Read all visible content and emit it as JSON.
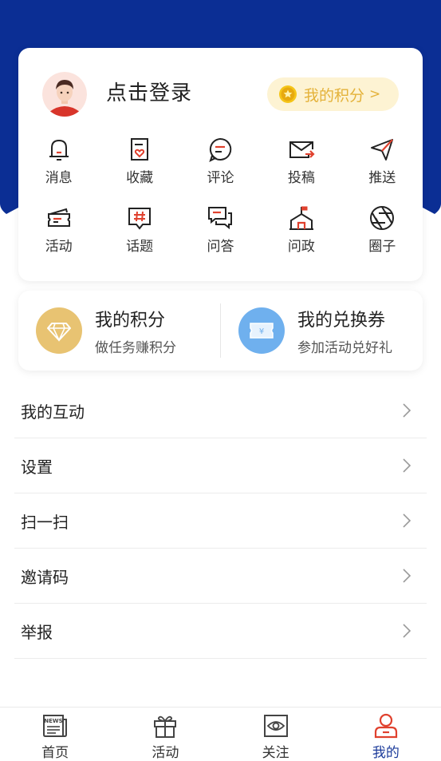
{
  "colors": {
    "brand_blue": "#0b2e94",
    "accent_red": "#e0412e",
    "gold": "#e4b23a",
    "pill_bg": "#fdf3d3",
    "active_tab": "#1c3b9a"
  },
  "profile": {
    "login_text": "点击登录",
    "points_pill": {
      "label": "我的积分",
      "arrow": ">"
    }
  },
  "grid": [
    [
      {
        "label": "消息",
        "icon": "bell-icon"
      },
      {
        "label": "收藏",
        "icon": "favorite-icon"
      },
      {
        "label": "评论",
        "icon": "comment-icon"
      },
      {
        "label": "投稿",
        "icon": "submit-mail-icon"
      },
      {
        "label": "推送",
        "icon": "send-icon"
      }
    ],
    [
      {
        "label": "活动",
        "icon": "ticket-icon"
      },
      {
        "label": "话题",
        "icon": "hashtag-icon"
      },
      {
        "label": "问答",
        "icon": "qa-icon"
      },
      {
        "label": "问政",
        "icon": "government-icon"
      },
      {
        "label": "圈子",
        "icon": "aperture-icon"
      }
    ]
  ],
  "rewards": {
    "points": {
      "title": "我的积分",
      "subtitle": "做任务赚积分",
      "icon": "diamond-icon",
      "color": "#e8c372"
    },
    "vouchers": {
      "title": "我的兑换券",
      "subtitle": "参加活动兑好礼",
      "icon": "voucher-icon",
      "color": "#6fb0ee"
    }
  },
  "menu": [
    {
      "label": "我的互动"
    },
    {
      "label": "设置"
    },
    {
      "label": "扫一扫"
    },
    {
      "label": "邀请码"
    },
    {
      "label": "举报"
    }
  ],
  "tabbar": [
    {
      "label": "首页",
      "icon": "news-icon",
      "active": false
    },
    {
      "label": "活动",
      "icon": "gift-icon",
      "active": false
    },
    {
      "label": "关注",
      "icon": "eye-icon",
      "active": false
    },
    {
      "label": "我的",
      "icon": "user-icon",
      "active": true
    }
  ]
}
